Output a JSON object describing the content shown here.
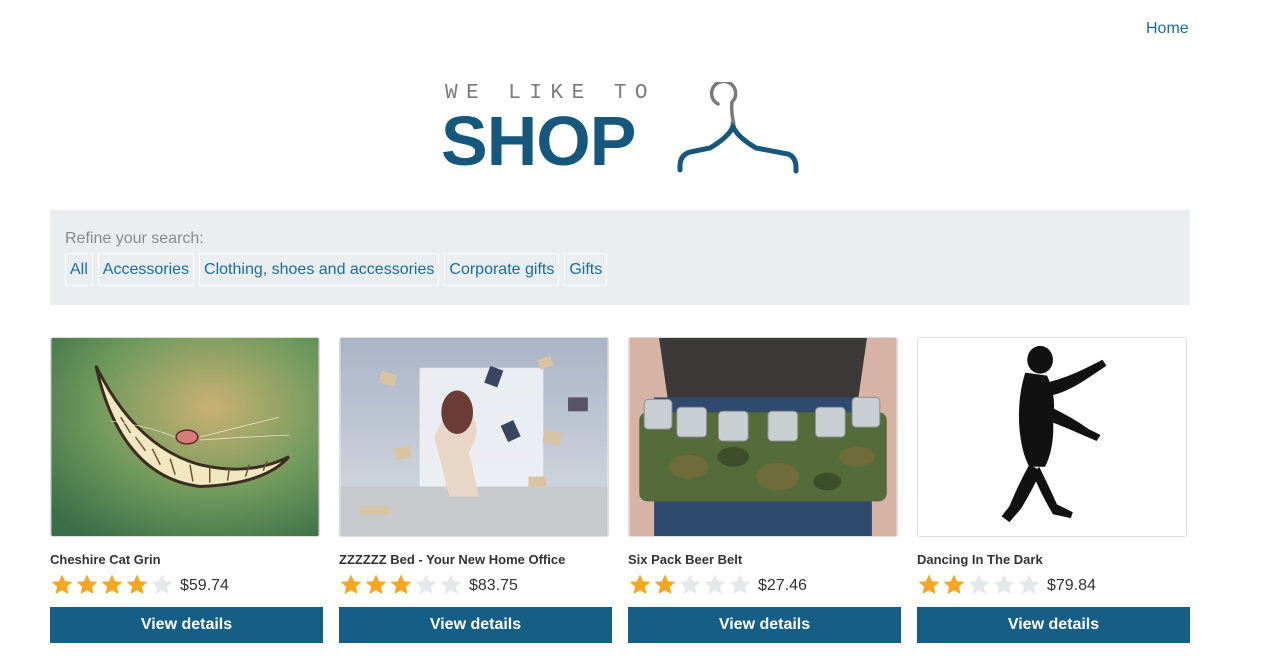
{
  "nav": {
    "home_label": "Home"
  },
  "logo": {
    "tagline": "WE LIKE TO",
    "wordmark": "SHOP",
    "icon": "hanger-icon"
  },
  "filter": {
    "label": "Refine your search:",
    "tags": [
      "All",
      "Accessories",
      "Clothing, shoes and accessories",
      "Corporate gifts",
      "Gifts"
    ]
  },
  "colors": {
    "accent": "#155f87",
    "link": "#1a6d9c",
    "star_on": "#f5a623",
    "star_off": "#e4e8eb",
    "filter_bg": "#eaeef1"
  },
  "products": [
    {
      "name": "Cheshire Cat Grin",
      "rating": 4,
      "max_rating": 5,
      "price": "$59.74",
      "button": "View details",
      "image": "cheshire-cat-grin-image"
    },
    {
      "name": "ZZZZZZ Bed - Your New Home Office",
      "rating": 3,
      "max_rating": 5,
      "price": "$83.75",
      "button": "View details",
      "image": "floating-books-bed-image"
    },
    {
      "name": "Six Pack Beer Belt",
      "rating": 2,
      "max_rating": 5,
      "price": "$27.46",
      "button": "View details",
      "image": "beer-belt-image"
    },
    {
      "name": "Dancing In The Dark",
      "rating": 2,
      "max_rating": 5,
      "price": "$79.84",
      "button": "View details",
      "image": "dancing-silhouette-image"
    }
  ]
}
